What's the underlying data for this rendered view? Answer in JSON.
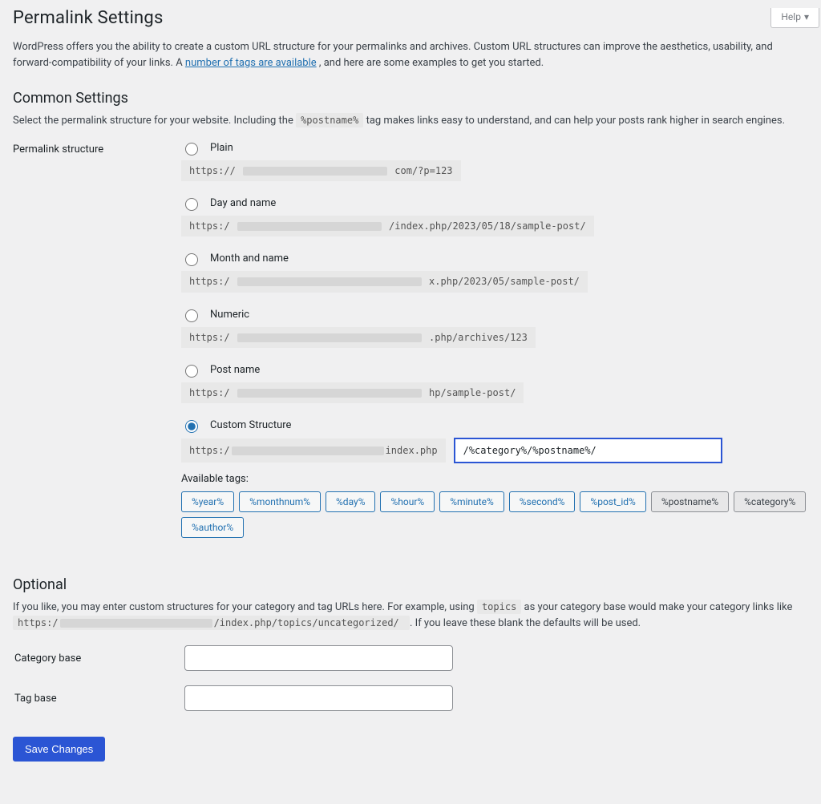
{
  "help_tab": "Help",
  "page_title": "Permalink Settings",
  "intro_before_link": "WordPress offers you the ability to create a custom URL structure for your permalinks and archives. Custom URL structures can improve the aesthetics, usability, and forward-compatibility of your links. A ",
  "intro_link_text": "number of tags are available",
  "intro_after_link": ", and here are some examples to get you started.",
  "common_settings_heading": "Common Settings",
  "common_desc_before": "Select the permalink structure for your website. Including the ",
  "common_desc_tag": "%postname%",
  "common_desc_after": " tag makes links easy to understand, and can help your posts rank higher in search engines.",
  "structure_label": "Permalink structure",
  "options": {
    "plain": {
      "label": "Plain",
      "pre": "https://",
      "post": "com/?p=123"
    },
    "day": {
      "label": "Day and name",
      "pre": "https:/",
      "post": "/index.php/2023/05/18/sample-post/"
    },
    "month": {
      "label": "Month and name",
      "pre": "https:/",
      "post": "x.php/2023/05/sample-post/"
    },
    "numeric": {
      "label": "Numeric",
      "pre": "https:/",
      "post": ".php/archives/123"
    },
    "postname": {
      "label": "Post name",
      "pre": "https:/",
      "post": "hp/sample-post/"
    },
    "custom": {
      "label": "Custom Structure",
      "pre": "https:/",
      "prefix_post": "index.php",
      "value": "/%category%/%postname%/"
    }
  },
  "available_tags_label": "Available tags:",
  "tags": [
    {
      "label": "%year%",
      "active": false
    },
    {
      "label": "%monthnum%",
      "active": false
    },
    {
      "label": "%day%",
      "active": false
    },
    {
      "label": "%hour%",
      "active": false
    },
    {
      "label": "%minute%",
      "active": false
    },
    {
      "label": "%second%",
      "active": false
    },
    {
      "label": "%post_id%",
      "active": false
    },
    {
      "label": "%postname%",
      "active": true
    },
    {
      "label": "%category%",
      "active": true
    },
    {
      "label": "%author%",
      "active": false
    }
  ],
  "optional_heading": "Optional",
  "optional_p1_a": "If you like, you may enter custom structures for your category and tag URLs here. For example, using ",
  "optional_p1_topics": "topics",
  "optional_p1_b": " as your category base would make your category links like ",
  "optional_code_pre": "https:/",
  "optional_code_post": "/index.php/topics/uncategorized/",
  "optional_p1_c": " . If you leave these blank the defaults will be used.",
  "category_base_label": "Category base",
  "tag_base_label": "Tag base",
  "save_label": "Save Changes"
}
